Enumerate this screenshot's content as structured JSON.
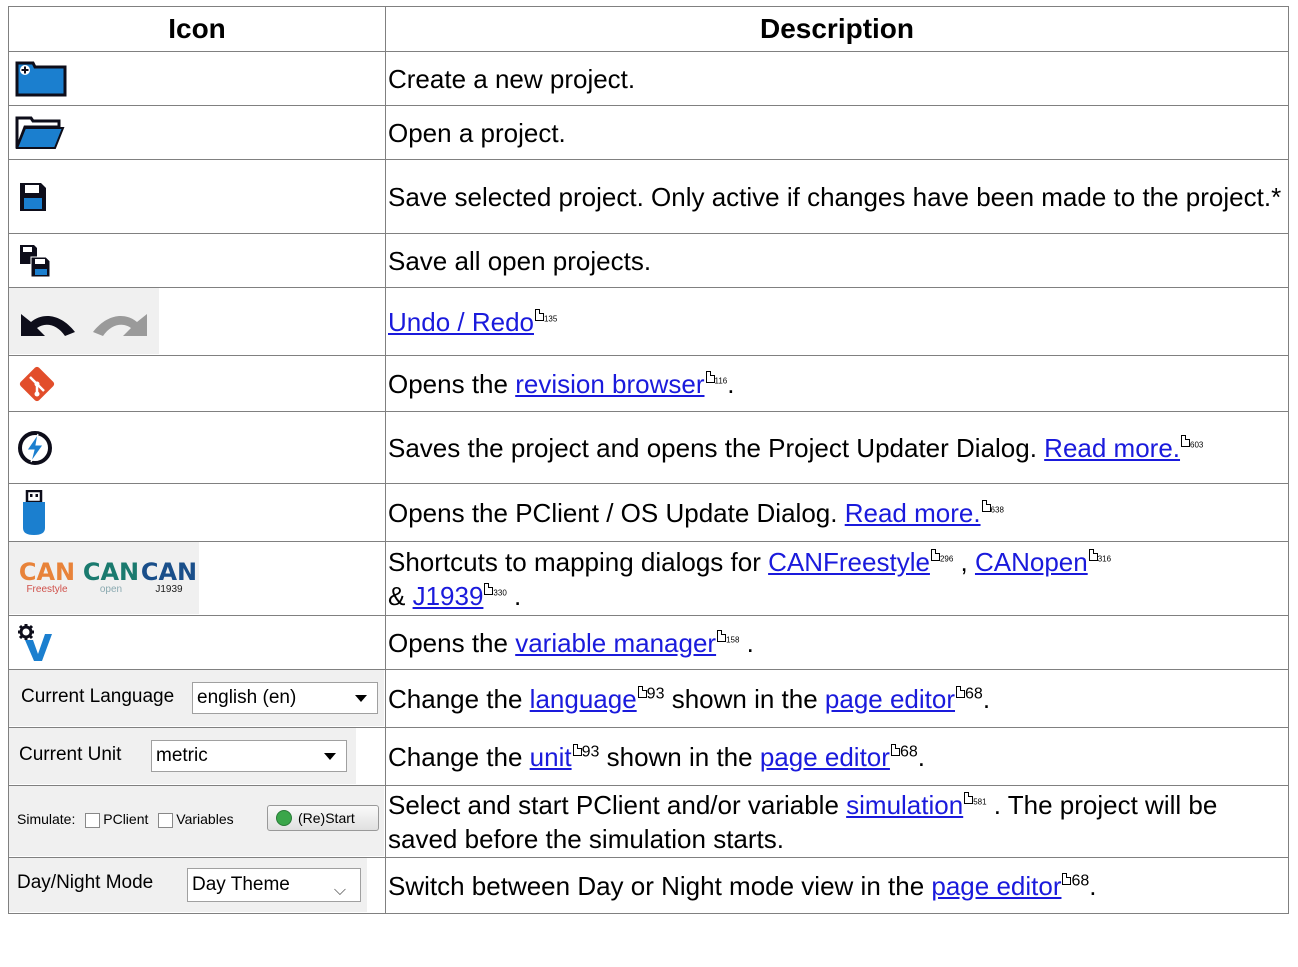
{
  "header": {
    "icon": "Icon",
    "description": "Description"
  },
  "rows": {
    "new_project": {
      "icon": "folder-plus-icon",
      "text": "Create a new project."
    },
    "open_project": {
      "icon": "folder-open-icon",
      "text": "Open a project."
    },
    "save_project": {
      "icon": "save-icon",
      "text": "Save selected project. Only active if changes have been made to the project.*"
    },
    "save_all": {
      "icon": "save-all-icon",
      "text": "Save all open projects."
    },
    "undo_redo": {
      "icon": "undo-redo-icon",
      "link": "Undo / Redo",
      "page": "135"
    },
    "revision": {
      "icon": "git-icon",
      "pre": "Opens the ",
      "link": "revision browser",
      "page": "116",
      "post": "."
    },
    "updater": {
      "icon": "lightning-icon",
      "pre": "Saves the project and opens the Project Updater Dialog. ",
      "link": "Read more.",
      "page": "603"
    },
    "pclient": {
      "icon": "usb-stick-icon",
      "pre": "Opens the PClient / OS Update Dialog. ",
      "link": "Read more.",
      "page": "638"
    },
    "can": {
      "icon_labels": [
        "CAN",
        "CAN",
        "CAN"
      ],
      "icon_sublabels": [
        "Freestyle",
        "open",
        "J1939"
      ],
      "pre": "Shortcuts to mapping dialogs for ",
      "link1": "CANFreestyle",
      "page1": "296",
      "sep1": " , ",
      "link2": "CANopen",
      "page2": "316",
      "sep2": "& ",
      "link3": "J1939",
      "page3": "330",
      "post": " ."
    },
    "variables": {
      "icon": "gear-v-icon",
      "pre": "Opens the ",
      "link": "variable manager",
      "page": "158",
      "post": " ."
    },
    "language": {
      "widget_label": "Current Language",
      "widget_value": "english (en)",
      "pre": "Change the ",
      "link1": "language",
      "page1": "93",
      "mid": " shown in the ",
      "link2": "page editor",
      "page2": "68",
      "post": "."
    },
    "unit": {
      "widget_label": "Current Unit",
      "widget_value": "metric",
      "pre": "Change the ",
      "link1": "unit",
      "page1": "93",
      "mid": " shown in the ",
      "link2": "page editor",
      "page2": "68",
      "post": "."
    },
    "simulate": {
      "widget_label": "Simulate:",
      "cb1": "PClient",
      "cb2": "Variables",
      "button": "(Re)Start",
      "pre": "Select and start PClient and/or variable ",
      "link": "simulation",
      "page": "581",
      "post": " . The project will be saved before the simulation starts."
    },
    "daynight": {
      "widget_label": "Day/Night Mode",
      "widget_value": "Day Theme",
      "pre": "Switch between Day or Night mode view in the ",
      "link": "page editor",
      "page": "68",
      "post": "."
    }
  }
}
